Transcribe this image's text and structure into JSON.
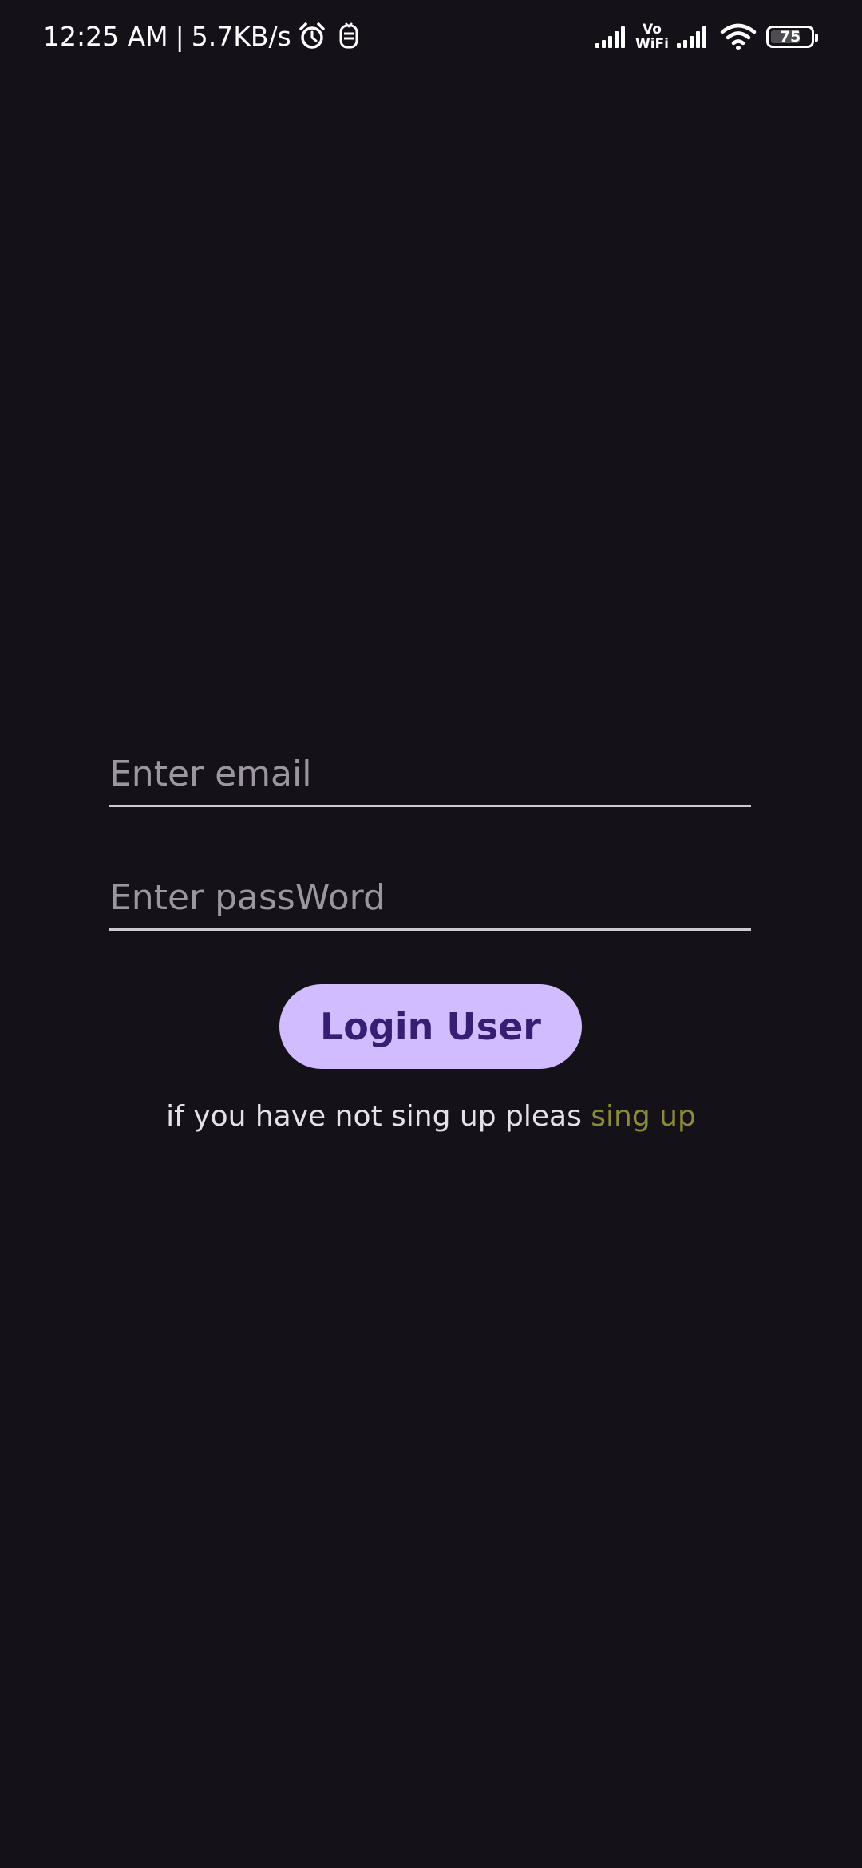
{
  "status_bar": {
    "time": "12:25 AM",
    "separator": "|",
    "network_speed": "5.7KB/s",
    "icons": [
      "alarm-icon",
      "notification-icon",
      "signal-icon",
      "vowifi-icon",
      "signal-icon",
      "wifi-icon",
      "battery-icon"
    ],
    "vowifi_top": "Vo",
    "vowifi_bottom": "WiFi",
    "battery_level": "75",
    "battery_fraction": 0.75
  },
  "login": {
    "email_placeholder": "Enter email",
    "email_value": "",
    "password_placeholder": "Enter passWord",
    "password_value": "",
    "login_button_label": "Login User",
    "signup_prompt": "if you have not sing up pleas",
    "signup_link": "sing up"
  },
  "colors": {
    "background": "#141218",
    "button_background": "#d0bcff",
    "button_text": "#381e72",
    "link": "#8d8b3a",
    "placeholder": "#9b96a0",
    "underline": "#cfc9d3"
  }
}
